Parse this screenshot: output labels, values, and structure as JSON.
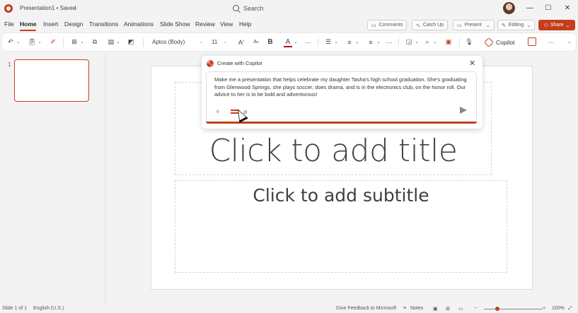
{
  "app": {
    "title": "Presentation1 • Saved",
    "search_placeholder": "Search"
  },
  "menu": {
    "tabs": [
      "File",
      "Home",
      "Insert",
      "Design",
      "Transitions",
      "Animations",
      "Slide Show",
      "Review",
      "View",
      "Help"
    ],
    "active": "Home"
  },
  "actions": {
    "comments": "Comments",
    "catch_up": "Catch Up",
    "present": "Present",
    "editing": "Editing",
    "share": "Share"
  },
  "ribbon": {
    "font_name": "Aptos (Body)",
    "font_size": "11",
    "bold_label": "B",
    "font_color_label": "A",
    "grow_font_label": "A",
    "more": "···",
    "copilot": "Copilot",
    "font_color": "#c00000"
  },
  "thumbnails": {
    "slide_number": "1"
  },
  "slide": {
    "title_placeholder": "Click to add title",
    "subtitle_placeholder": "Click to add subtitle"
  },
  "copilot": {
    "dialog_title": "Create with Copilot",
    "prompt": "Make me a presentation that helps celebrate my daughter Tasha's high school graduation. She's graduating from Glenwood Springs, she plays soccer, does drama, and is in the electronics club, on the honor roll. Our advice to her is to be bold and adventurous!",
    "accent_color": "#c43e1c"
  },
  "status": {
    "slide_of": "Slide 1 of 1",
    "language": "English (U.S.)",
    "feedback": "Give Feedback to Microsoft",
    "notes": "Notes",
    "zoom": "100%"
  }
}
